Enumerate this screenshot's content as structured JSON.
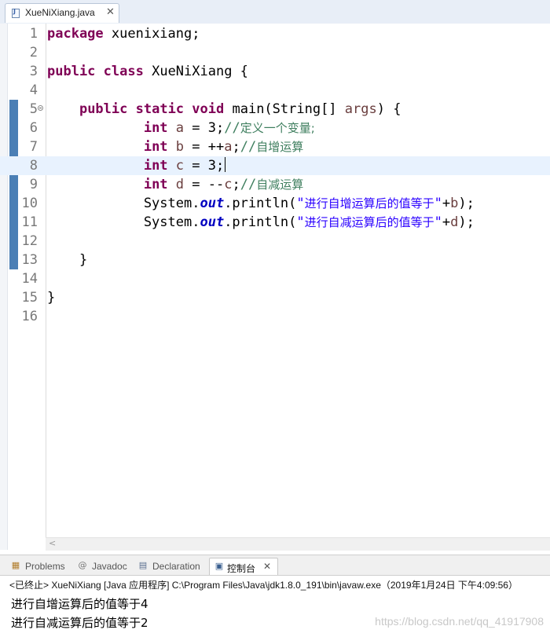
{
  "editor_tab": {
    "filename": "XueNiXiang.java",
    "close_glyph": "✕"
  },
  "editor": {
    "lines": [
      {
        "num": "1",
        "tokens": [
          [
            "kw",
            "package"
          ],
          [
            "plain",
            " xuenixiang;"
          ]
        ]
      },
      {
        "num": "2",
        "tokens": []
      },
      {
        "num": "3",
        "tokens": [
          [
            "kw",
            "public"
          ],
          [
            "plain",
            " "
          ],
          [
            "kw",
            "class"
          ],
          [
            "plain",
            " XueNiXiang {"
          ]
        ]
      },
      {
        "num": "4",
        "tokens": []
      },
      {
        "num": "5",
        "fold": true,
        "tokens": [
          [
            "plain",
            "    "
          ],
          [
            "kw",
            "public"
          ],
          [
            "plain",
            " "
          ],
          [
            "kw",
            "static"
          ],
          [
            "plain",
            " "
          ],
          [
            "kw",
            "void"
          ],
          [
            "plain",
            " main(String[] "
          ],
          [
            "var",
            "args"
          ],
          [
            "plain",
            ") {"
          ]
        ]
      },
      {
        "num": "6",
        "tokens": [
          [
            "plain",
            "            "
          ],
          [
            "kw",
            "int"
          ],
          [
            "plain",
            " "
          ],
          [
            "var",
            "a"
          ],
          [
            "plain",
            " = 3;"
          ],
          [
            "cm",
            "//"
          ],
          [
            "cmcjk",
            "定义一个变量;"
          ]
        ]
      },
      {
        "num": "7",
        "tokens": [
          [
            "plain",
            "            "
          ],
          [
            "kw",
            "int"
          ],
          [
            "plain",
            " "
          ],
          [
            "var",
            "b"
          ],
          [
            "plain",
            " = ++"
          ],
          [
            "var",
            "a"
          ],
          [
            "plain",
            ";"
          ],
          [
            "cm",
            "//"
          ],
          [
            "cmcjk",
            "自增运算"
          ]
        ]
      },
      {
        "num": "8",
        "current": true,
        "caret": true,
        "tokens": [
          [
            "plain",
            "            "
          ],
          [
            "kw",
            "int"
          ],
          [
            "plain",
            " "
          ],
          [
            "var",
            "c"
          ],
          [
            "plain",
            " = 3;"
          ]
        ]
      },
      {
        "num": "9",
        "tokens": [
          [
            "plain",
            "            "
          ],
          [
            "kw",
            "int"
          ],
          [
            "plain",
            " "
          ],
          [
            "var",
            "d"
          ],
          [
            "plain",
            " = --"
          ],
          [
            "var",
            "c"
          ],
          [
            "plain",
            ";"
          ],
          [
            "cm",
            "//"
          ],
          [
            "cmcjk",
            "自减运算"
          ]
        ]
      },
      {
        "num": "10",
        "tokens": [
          [
            "plain",
            "            System."
          ],
          [
            "fld",
            "out"
          ],
          [
            "plain",
            ".println("
          ],
          [
            "str",
            "\""
          ],
          [
            "strcjk",
            "进行自增运算后的值等于"
          ],
          [
            "str",
            "\""
          ],
          [
            "plain",
            "+"
          ],
          [
            "var",
            "b"
          ],
          [
            "plain",
            ");"
          ]
        ]
      },
      {
        "num": "11",
        "tokens": [
          [
            "plain",
            "            System."
          ],
          [
            "fld",
            "out"
          ],
          [
            "plain",
            ".println("
          ],
          [
            "str",
            "\""
          ],
          [
            "strcjk",
            "进行自减运算后的值等于"
          ],
          [
            "str",
            "\""
          ],
          [
            "plain",
            "+"
          ],
          [
            "var",
            "d"
          ],
          [
            "plain",
            ");"
          ]
        ]
      },
      {
        "num": "12",
        "tokens": []
      },
      {
        "num": "13",
        "tokens": [
          [
            "plain",
            "    }"
          ]
        ]
      },
      {
        "num": "14",
        "tokens": []
      },
      {
        "num": "15",
        "tokens": [
          [
            "plain",
            "}"
          ]
        ]
      },
      {
        "num": "16",
        "tokens": []
      }
    ],
    "scroll_left_glyph": "<"
  },
  "panel": {
    "tabs": [
      {
        "name": "problems",
        "label": "Problems",
        "icon": "▦",
        "icon_color": "#b07c2a"
      },
      {
        "name": "javadoc",
        "label": "Javadoc",
        "icon": "@",
        "icon_color": "#777777"
      },
      {
        "name": "declaration",
        "label": "Declaration",
        "icon": "▤",
        "icon_color": "#5a6f8f"
      },
      {
        "name": "console",
        "label": "控制台",
        "icon": "▣",
        "icon_color": "#3a5f8f",
        "active": true,
        "close_glyph": "✕"
      }
    ],
    "console_header": "<已终止> XueNiXiang [Java 应用程序] C:\\Program Files\\Java\\jdk1.8.0_191\\bin\\javaw.exe（2019年1月24日 下午4:09:56）",
    "console_output": [
      "进行自增运算后的值等于4",
      "进行自减运算后的值等于2"
    ],
    "watermark": "https://blog.csdn.net/qq_41917908"
  },
  "colors": {
    "keyword": "#7f0055",
    "comment": "#3f7f5f",
    "string": "#2a00ff",
    "field": "#0000c0",
    "local_var": "#6a3e3e",
    "current_line": "#e8f2fe",
    "change_bar": "#4b7fb5"
  }
}
